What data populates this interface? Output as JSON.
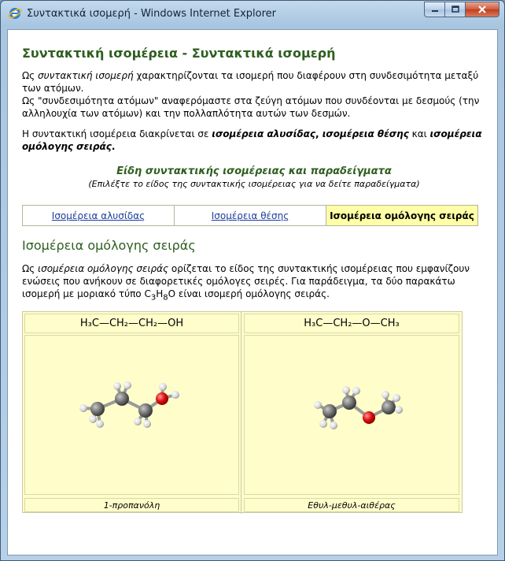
{
  "window": {
    "title": "Συντακτικά ισομερή - Windows Internet Explorer"
  },
  "page": {
    "title": "Συντακτική ισομέρεια - Συντακτικά ισομερή",
    "intro_line1_a": "Ως ",
    "intro_line1_em": "συντακτική ισομερή",
    "intro_line1_b": " χαρακτηρίζονται τα ισομερή που διαφέρουν στη συνδεσιμότητα μεταξύ των ατόμων.",
    "intro_line2": "Ως \"συνδεσιμότητα ατόμων\" αναφερόμαστε στα ζεύγη ατόμων που συνδέονται με δεσμούς (την αλληλουχία των ατόμων) και την πολλαπλότητα αυτών των δεσμών.",
    "classes_a": "Η συντακτική ισομέρεια διακρίνεται σε ",
    "classes_b1": "ισομέρεια αλυσίδας",
    "classes_sep": ", ",
    "classes_b2": "ισομέρεια θέσης",
    "classes_and": " και ",
    "classes_b3": "ισομέρεια ομόλογης σειράς",
    "classes_end": ".",
    "section_heading": "Είδη συντακτικής ισομέρειας και παραδείγματα",
    "section_sub": "(Επιλέξτε το είδος της συντακτικής ισομέρειας για να δείτε παραδείγματα)",
    "tabs": [
      {
        "label": "Ισομέρεια αλυσίδας",
        "active": false
      },
      {
        "label": "Ισομέρεια θέσης",
        "active": false
      },
      {
        "label": "Ισομέρεια ομόλογης σειράς",
        "active": true
      }
    ],
    "detail_heading": "Ισομέρεια ομόλογης σειράς",
    "detail_a": "Ως ",
    "detail_em": "ισομέρεια ομόλογης σειράς",
    "detail_b": " ορίζεται το είδος της συντακτικής ισομέρειας που εμφανίζουν ενώσεις που ανήκουν σε διαφορετικές ομόλογες σειρές. Για παράδειγμα, τα δύο παρακάτω ισομερή με μοριακό τύπο C",
    "detail_sub3": "3",
    "detail_H": "H",
    "detail_sub8": "8",
    "detail_c": "O είναι ισομερή ομόλογης σειράς.",
    "molecules": [
      {
        "formula": "H₃C—CH₂—CH₂—OH",
        "name": "1-προπανόλη"
      },
      {
        "formula": "H₃C—CH₂—O—CH₃",
        "name": "Εθυλ-μεθυλ-αιθέρας"
      }
    ]
  },
  "colors": {
    "heading_green": "#2e5e1f",
    "active_tab": "#ffffa8",
    "molecule_bg": "#fffecb",
    "link": "#1a3d9c"
  },
  "icons": [
    "ie-icon",
    "minimize-icon",
    "maximize-icon",
    "close-icon"
  ]
}
